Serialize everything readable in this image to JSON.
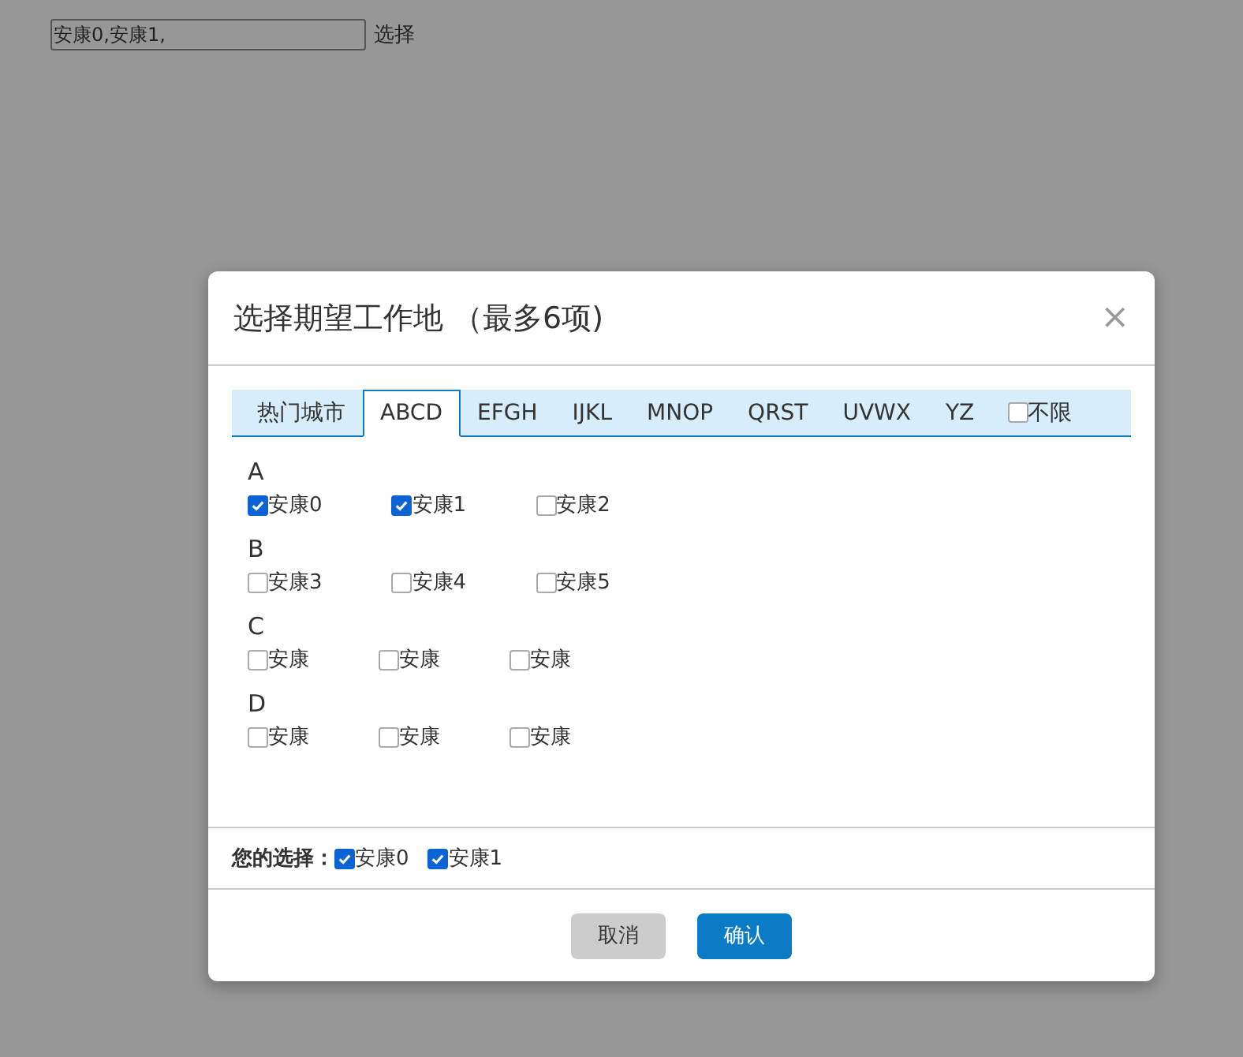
{
  "top_field": {
    "value": "安康0,安康1,"
  },
  "top_link": "选择",
  "dialog": {
    "title": "选择期望工作地 （最多6项)",
    "close": "×",
    "tabs": [
      {
        "kind": "tab",
        "label": "热门城市",
        "selected": false
      },
      {
        "kind": "tab",
        "label": "ABCD",
        "selected": true
      },
      {
        "kind": "tab",
        "label": "EFGH",
        "selected": false
      },
      {
        "kind": "tab",
        "label": "IJKL",
        "selected": false
      },
      {
        "kind": "tab",
        "label": "MNOP",
        "selected": false
      },
      {
        "kind": "tab",
        "label": "QRST",
        "selected": false
      },
      {
        "kind": "tab",
        "label": "UVWX",
        "selected": false
      },
      {
        "kind": "tab",
        "label": "YZ",
        "selected": false
      },
      {
        "kind": "checkbox",
        "label": "不限",
        "checked": false
      }
    ],
    "groups": [
      {
        "letter": "A",
        "items": [
          {
            "label": "安康0",
            "checked": true
          },
          {
            "label": "安康1",
            "checked": true
          },
          {
            "label": "安康2",
            "checked": false
          }
        ]
      },
      {
        "letter": "B",
        "items": [
          {
            "label": "安康3",
            "checked": false
          },
          {
            "label": "安康4",
            "checked": false
          },
          {
            "label": "安康5",
            "checked": false
          }
        ]
      },
      {
        "letter": "C",
        "items": [
          {
            "label": "安康",
            "checked": false
          },
          {
            "label": "安康",
            "checked": false
          },
          {
            "label": "安康",
            "checked": false
          }
        ]
      },
      {
        "letter": "D",
        "items": [
          {
            "label": "安康",
            "checked": false
          },
          {
            "label": "安康",
            "checked": false
          },
          {
            "label": "安康",
            "checked": false
          }
        ]
      }
    ],
    "selection_label": "您的选择：",
    "selection": [
      {
        "label": "安康0",
        "checked": true
      },
      {
        "label": "安康1",
        "checked": true
      }
    ],
    "buttons": [
      {
        "kind": "cancel",
        "label": "取消"
      },
      {
        "kind": "confirm",
        "label": "确认"
      }
    ]
  }
}
